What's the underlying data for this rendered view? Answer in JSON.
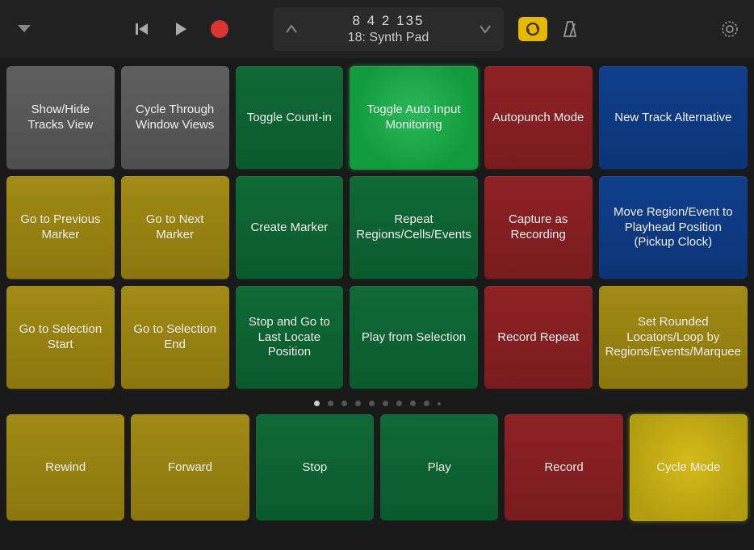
{
  "toolbar": {
    "display_top": "8  4  2  135",
    "display_bottom": "18: Synth Pad"
  },
  "grid": {
    "rows": [
      [
        {
          "label": "Show/Hide Tracks View",
          "color": "grey",
          "name": "show-hide-tracks-view"
        },
        {
          "label": "Cycle Through Window Views",
          "color": "grey",
          "name": "cycle-through-window-views"
        },
        {
          "label": "Toggle Count-in",
          "color": "green",
          "name": "toggle-count-in"
        },
        {
          "label": "Toggle Auto Input Monitoring",
          "color": "green-bright",
          "name": "toggle-auto-input-monitoring"
        },
        {
          "label": "Autopunch Mode",
          "color": "red",
          "name": "autopunch-mode"
        },
        {
          "label": "New Track Alternative",
          "color": "blue",
          "name": "new-track-alternative"
        }
      ],
      [
        {
          "label": "Go to Previous Marker",
          "color": "olive",
          "name": "go-to-previous-marker"
        },
        {
          "label": "Go to Next Marker",
          "color": "olive",
          "name": "go-to-next-marker"
        },
        {
          "label": "Create Marker",
          "color": "green",
          "name": "create-marker"
        },
        {
          "label": "Repeat Regions/Cells/Events",
          "color": "green",
          "name": "repeat-regions-cells-events"
        },
        {
          "label": "Capture as Recording",
          "color": "red",
          "name": "capture-as-recording"
        },
        {
          "label": "Move Region/Event to Playhead Position (Pickup Clock)",
          "color": "blue",
          "name": "move-region-to-playhead"
        }
      ],
      [
        {
          "label": "Go to Selection Start",
          "color": "olive",
          "name": "go-to-selection-start"
        },
        {
          "label": "Go to Selection End",
          "color": "olive",
          "name": "go-to-selection-end"
        },
        {
          "label": "Stop and Go to Last Locate Position",
          "color": "green",
          "name": "stop-go-to-last-locate"
        },
        {
          "label": "Play from Selection",
          "color": "green",
          "name": "play-from-selection"
        },
        {
          "label": "Record Repeat",
          "color": "red",
          "name": "record-repeat"
        },
        {
          "label": "Set Rounded Locators/Loop by Regions/Events/Marquee",
          "color": "olive",
          "name": "set-rounded-locators"
        }
      ]
    ]
  },
  "dots": {
    "count": 10,
    "active": 0
  },
  "transport": [
    {
      "label": "Rewind",
      "color": "olive",
      "name": "rewind-button"
    },
    {
      "label": "Forward",
      "color": "olive",
      "name": "forward-button"
    },
    {
      "label": "Stop",
      "color": "green",
      "name": "stop-button"
    },
    {
      "label": "Play",
      "color": "green",
      "name": "play-button"
    },
    {
      "label": "Record",
      "color": "red",
      "name": "record-button"
    },
    {
      "label": "Cycle Mode",
      "color": "olive-bright",
      "name": "cycle-mode-button"
    }
  ]
}
